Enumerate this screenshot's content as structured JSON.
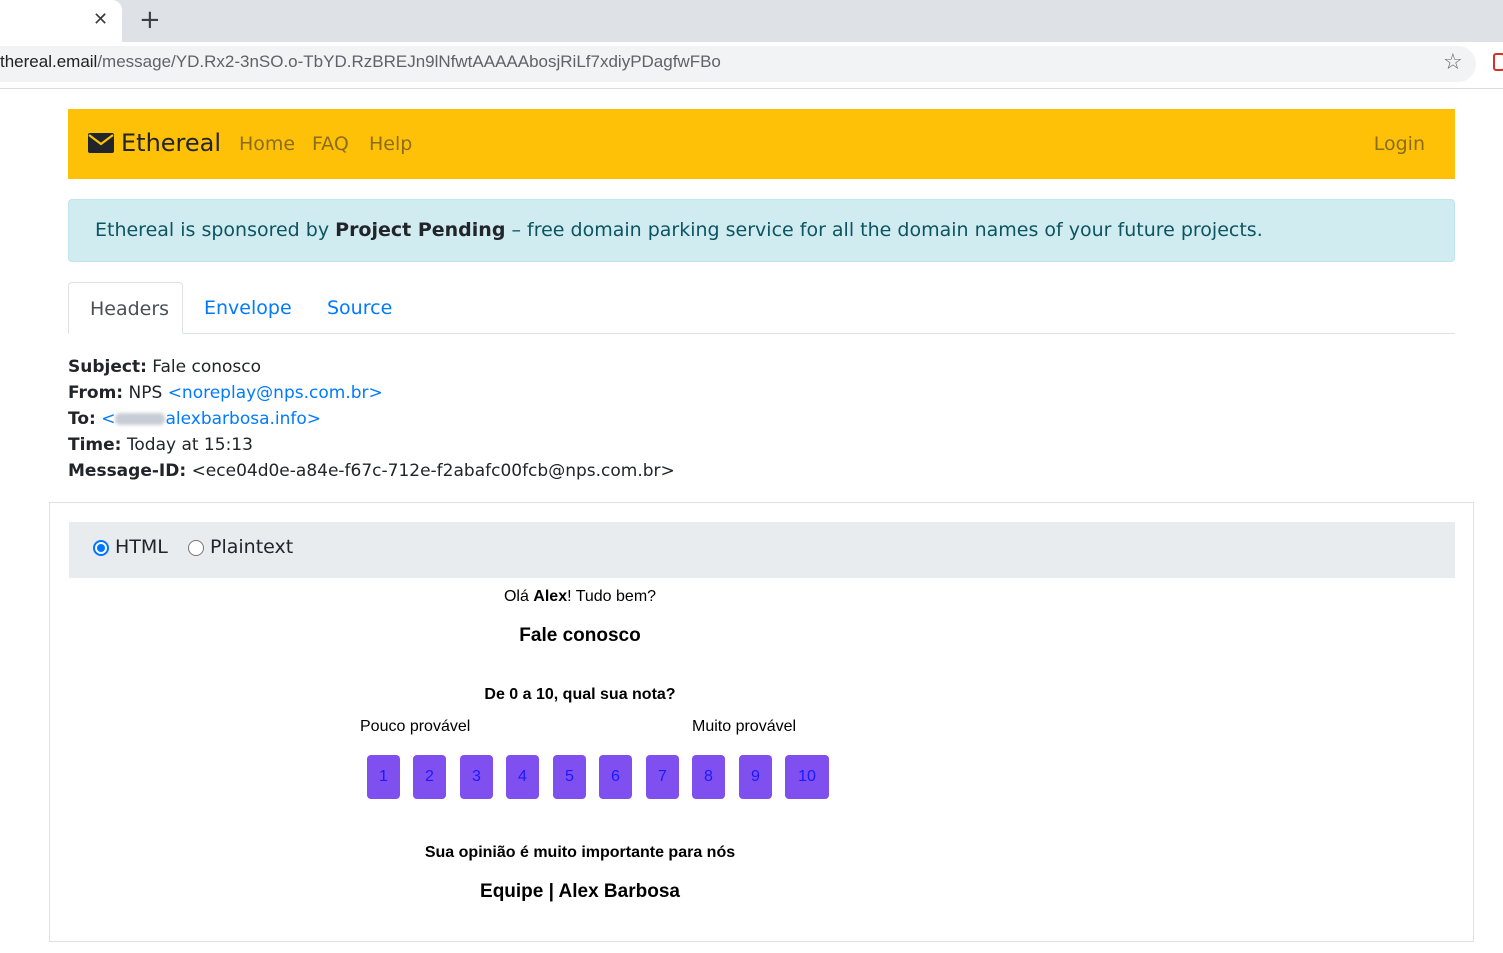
{
  "browser": {
    "tab_close": "✕",
    "new_tab": "+",
    "url_host": "thereal.email",
    "url_path": "/message/YD.Rx2-3nSO.o-TbYD.RzBREJn9lNfwtAAAAAbosjRiLf7xdiyPDagfwFBo",
    "star_icon": "☆"
  },
  "navbar": {
    "brand": "Ethereal",
    "links": [
      "Home",
      "FAQ",
      "Help"
    ],
    "login": "Login",
    "color": "#ffc107"
  },
  "alert": {
    "prefix": "Ethereal is sponsored by ",
    "sponsor": "Project Pending",
    "suffix": " – free domain parking service for all the domain names of your future projects."
  },
  "tabs": [
    "Headers",
    "Envelope",
    "Source"
  ],
  "headers": {
    "subject_label": "Subject:",
    "subject": "Fale conosco",
    "from_label": "From:",
    "from_name": "NPS",
    "from_email": "<noreplay@nps.com.br>",
    "to_label": "To:",
    "to_prefix": "<",
    "to_email": "alexbarbosa.info>",
    "time_label": "Time:",
    "time": "Today at 15:13",
    "message_id_label": "Message-ID:",
    "message_id": "<ece04d0e-a84e-f67c-712e-f2abafc00fcb@nps.com.br>"
  },
  "view": {
    "html_label": "HTML",
    "plain_label": "Plaintext",
    "selected": "HTML"
  },
  "email": {
    "greeting_prefix": "Olá ",
    "greeting_name": "Alex",
    "greeting_suffix": "! Tudo bem?",
    "title": "Fale conosco",
    "question": "De 0 a 10, qual sua nota?",
    "low_label": "Pouco provável",
    "high_label": "Muito provável",
    "scores": [
      "1",
      "2",
      "3",
      "4",
      "5",
      "6",
      "7",
      "8",
      "9",
      "10"
    ],
    "footer1": "Sua opinião é muito importante para nós",
    "footer2": "Equipe | Alex Barbosa",
    "button_color": "#7f4ff0"
  }
}
